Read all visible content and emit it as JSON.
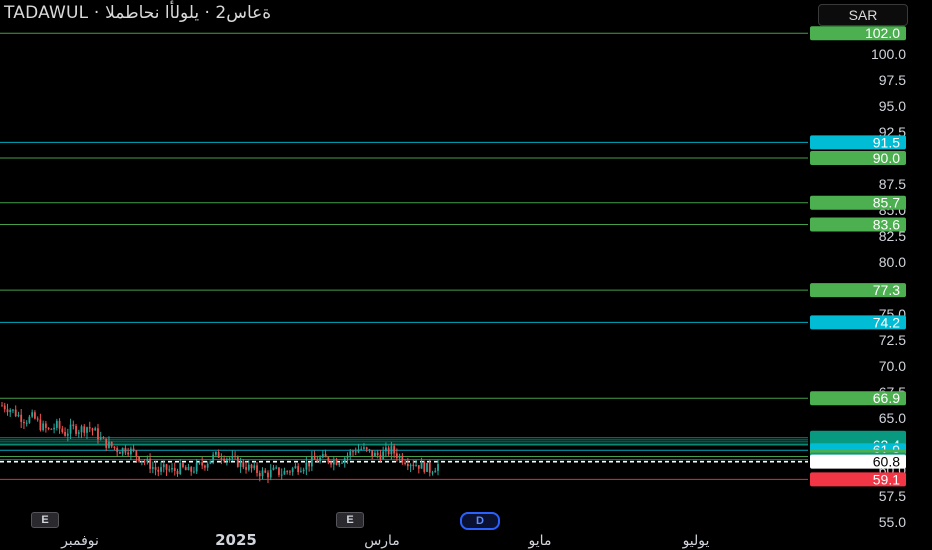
{
  "header": {
    "title": "TADAWUL · ةعاس2 · يلولأا نحاطملا",
    "currency": "SAR"
  },
  "badges": {
    "earnings_label": "E",
    "dividend_label": "D"
  },
  "colors": {
    "green": "#4caf50",
    "teal": "#089981",
    "cyan": "#00bcd4",
    "red": "#f23645",
    "white": "#ffffff",
    "up": "#26a69a",
    "down": "#ef5350"
  },
  "chart_data": {
    "type": "candlestick",
    "timeframe": "D",
    "y_axis": {
      "range": [
        55.0,
        104.5
      ],
      "ticks": [
        "55.0",
        "57.5",
        "60.0",
        "62.5",
        "65.0",
        "67.5",
        "70.0",
        "72.5",
        "75.0",
        "77.5",
        "80.0",
        "82.5",
        "85.0",
        "87.5",
        "90.0",
        "92.5",
        "95.0",
        "97.5",
        "100.0"
      ]
    },
    "x_axis": {
      "labels": [
        "نوفمبر",
        "2025",
        "مارس",
        "مايو",
        "يوليو"
      ]
    },
    "horizontal_levels": [
      {
        "value": 102.0,
        "label": "102.0",
        "color": "green"
      },
      {
        "value": 91.5,
        "label": "91.5",
        "color": "cyan"
      },
      {
        "value": 90.0,
        "label": "90.0",
        "color": "green"
      },
      {
        "value": 85.7,
        "label": "85.7",
        "color": "green"
      },
      {
        "value": 83.6,
        "label": "83.6",
        "color": "green"
      },
      {
        "value": 77.3,
        "label": "77.3",
        "color": "green"
      },
      {
        "value": 74.2,
        "label": "74.2",
        "color": "cyan"
      },
      {
        "value": 66.9,
        "label": "66.9",
        "color": "green"
      },
      {
        "value": 63.1,
        "label": "63.1",
        "color": "teal"
      },
      {
        "value": 62.9,
        "label": "62.9",
        "color": "teal"
      },
      {
        "value": 62.7,
        "label": "62.7",
        "color": "teal"
      },
      {
        "value": 62.5,
        "label": "62.5",
        "color": "teal"
      },
      {
        "value": 62.4,
        "label": "62.4",
        "color": "teal"
      },
      {
        "value": 61.9,
        "label": "61.9",
        "color": "cyan"
      },
      {
        "value": 61.3,
        "label": "61.3",
        "color": "green"
      },
      {
        "value": 61.0,
        "label": "61.0",
        "color": "teal"
      },
      {
        "value": 60.8,
        "label": "60.8",
        "color": "white",
        "dashed": true
      },
      {
        "value": 59.1,
        "label": "59.1",
        "color": "red"
      }
    ],
    "price_path": [
      66.2,
      65.9,
      65.3,
      64.8,
      65.1,
      64.2,
      63.8,
      64.3,
      63.5,
      64.0,
      63.9,
      64.2,
      63.6,
      62.7,
      62.3,
      61.9,
      62.1,
      61.6,
      61.0,
      60.5,
      59.9,
      60.1,
      59.9,
      60.2,
      59.8,
      60.3,
      60.6,
      61.2,
      61.5,
      61.2,
      60.8,
      60.5,
      60.1,
      59.8,
      59.6,
      59.9,
      59.7,
      60.0,
      60.3,
      60.5,
      60.9,
      61.1,
      61.0,
      60.9,
      61.2,
      61.8,
      62.1,
      61.7,
      61.4,
      61.6,
      61.9,
      61.3,
      60.9,
      60.6,
      60.4,
      60.0,
      60.5
    ]
  }
}
